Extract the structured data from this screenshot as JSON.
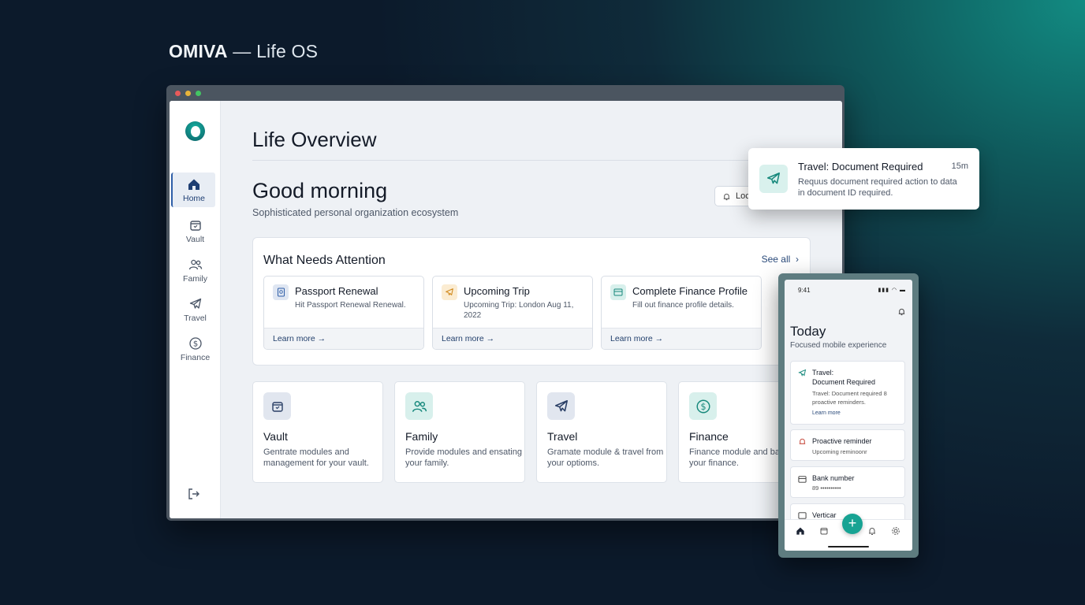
{
  "brand": {
    "name": "OMIVA",
    "rest": " — Life OS"
  },
  "window": {
    "dots": [
      "#e85a5a",
      "#e8b43a",
      "#43c463"
    ]
  },
  "sidebar": {
    "items": [
      {
        "label": "Home",
        "icon": "home-icon"
      },
      {
        "label": "Vault",
        "icon": "vault-icon"
      },
      {
        "label": "Family",
        "icon": "family-icon"
      },
      {
        "label": "Travel",
        "icon": "plane-icon"
      },
      {
        "label": "Finance",
        "icon": "dollar-icon"
      }
    ]
  },
  "main": {
    "title": "Life Overview",
    "greeting": "Good morning",
    "subtitle": "Sophisticated personal organization ecosystem",
    "lock_label": "Loc"
  },
  "attention": {
    "heading": "What Needs Attention",
    "see_all": "See all",
    "cards": [
      {
        "title": "Passport Renewal",
        "desc": "Hit Passport Renewal Renewal.",
        "link": "Learn more →",
        "icon": "passport-icon"
      },
      {
        "title": "Upcoming Trip",
        "desc": "Upcoming Trip: London Aug 11, 2022",
        "link": "Learn more →",
        "icon": "plane-icon"
      },
      {
        "title": "Complete Finance Profile",
        "desc": "Fill out finance profile details.",
        "link": "Learn more →",
        "icon": "card-icon"
      }
    ]
  },
  "modules": [
    {
      "title": "Vault",
      "desc": "Gentrate modules and management for your vault.",
      "icon": "vault-icon"
    },
    {
      "title": "Family",
      "desc": "Provide modules and ensating your family.",
      "icon": "family-icon"
    },
    {
      "title": "Travel",
      "desc": "Gramate module & travel from your optioms.",
      "icon": "plane-icon"
    },
    {
      "title": "Finance",
      "desc": "Finance module and bank on your finance.",
      "icon": "dollar-icon"
    }
  ],
  "toast": {
    "title": "Travel: Document Required",
    "time": "15m",
    "desc": "Requus document required action to data in document ID required."
  },
  "phone": {
    "time": "9:41",
    "status": "▮▮▮ ◠ ▬",
    "title": "Today",
    "subtitle": "Focused mobile experience",
    "cards": [
      {
        "title": "Travel:\nDocument Required",
        "desc": "Travel: Document required 8 proactive reminders.",
        "link": "Learn more"
      },
      {
        "title": "Proactive reminder",
        "desc": "Upcoming reminoonr"
      },
      {
        "title": "Bank number",
        "desc": "89 ••••••••••"
      },
      {
        "title": "Verticar"
      }
    ],
    "fab": "+"
  },
  "colors": {
    "accent": "#17a393",
    "nav_active": "#2f5fa8"
  }
}
